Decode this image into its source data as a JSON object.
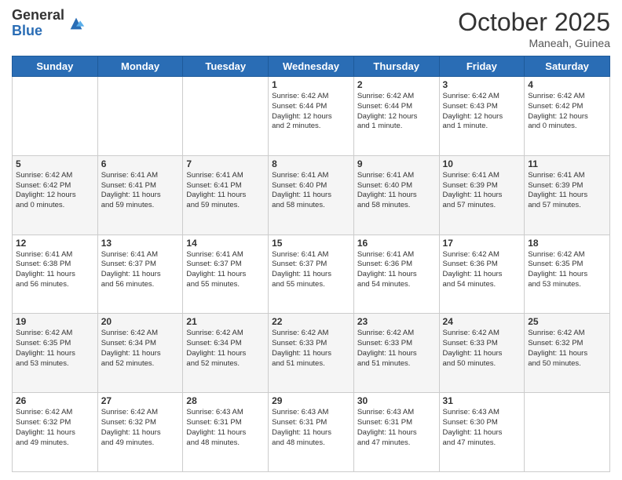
{
  "header": {
    "logo_general": "General",
    "logo_blue": "Blue",
    "month": "October 2025",
    "location": "Maneah, Guinea"
  },
  "days_of_week": [
    "Sunday",
    "Monday",
    "Tuesday",
    "Wednesday",
    "Thursday",
    "Friday",
    "Saturday"
  ],
  "weeks": [
    [
      {
        "day": "",
        "info": ""
      },
      {
        "day": "",
        "info": ""
      },
      {
        "day": "",
        "info": ""
      },
      {
        "day": "1",
        "info": "Sunrise: 6:42 AM\nSunset: 6:44 PM\nDaylight: 12 hours\nand 2 minutes."
      },
      {
        "day": "2",
        "info": "Sunrise: 6:42 AM\nSunset: 6:44 PM\nDaylight: 12 hours\nand 1 minute."
      },
      {
        "day": "3",
        "info": "Sunrise: 6:42 AM\nSunset: 6:43 PM\nDaylight: 12 hours\nand 1 minute."
      },
      {
        "day": "4",
        "info": "Sunrise: 6:42 AM\nSunset: 6:42 PM\nDaylight: 12 hours\nand 0 minutes."
      }
    ],
    [
      {
        "day": "5",
        "info": "Sunrise: 6:42 AM\nSunset: 6:42 PM\nDaylight: 12 hours\nand 0 minutes."
      },
      {
        "day": "6",
        "info": "Sunrise: 6:41 AM\nSunset: 6:41 PM\nDaylight: 11 hours\nand 59 minutes."
      },
      {
        "day": "7",
        "info": "Sunrise: 6:41 AM\nSunset: 6:41 PM\nDaylight: 11 hours\nand 59 minutes."
      },
      {
        "day": "8",
        "info": "Sunrise: 6:41 AM\nSunset: 6:40 PM\nDaylight: 11 hours\nand 58 minutes."
      },
      {
        "day": "9",
        "info": "Sunrise: 6:41 AM\nSunset: 6:40 PM\nDaylight: 11 hours\nand 58 minutes."
      },
      {
        "day": "10",
        "info": "Sunrise: 6:41 AM\nSunset: 6:39 PM\nDaylight: 11 hours\nand 57 minutes."
      },
      {
        "day": "11",
        "info": "Sunrise: 6:41 AM\nSunset: 6:39 PM\nDaylight: 11 hours\nand 57 minutes."
      }
    ],
    [
      {
        "day": "12",
        "info": "Sunrise: 6:41 AM\nSunset: 6:38 PM\nDaylight: 11 hours\nand 56 minutes."
      },
      {
        "day": "13",
        "info": "Sunrise: 6:41 AM\nSunset: 6:37 PM\nDaylight: 11 hours\nand 56 minutes."
      },
      {
        "day": "14",
        "info": "Sunrise: 6:41 AM\nSunset: 6:37 PM\nDaylight: 11 hours\nand 55 minutes."
      },
      {
        "day": "15",
        "info": "Sunrise: 6:41 AM\nSunset: 6:37 PM\nDaylight: 11 hours\nand 55 minutes."
      },
      {
        "day": "16",
        "info": "Sunrise: 6:41 AM\nSunset: 6:36 PM\nDaylight: 11 hours\nand 54 minutes."
      },
      {
        "day": "17",
        "info": "Sunrise: 6:42 AM\nSunset: 6:36 PM\nDaylight: 11 hours\nand 54 minutes."
      },
      {
        "day": "18",
        "info": "Sunrise: 6:42 AM\nSunset: 6:35 PM\nDaylight: 11 hours\nand 53 minutes."
      }
    ],
    [
      {
        "day": "19",
        "info": "Sunrise: 6:42 AM\nSunset: 6:35 PM\nDaylight: 11 hours\nand 53 minutes."
      },
      {
        "day": "20",
        "info": "Sunrise: 6:42 AM\nSunset: 6:34 PM\nDaylight: 11 hours\nand 52 minutes."
      },
      {
        "day": "21",
        "info": "Sunrise: 6:42 AM\nSunset: 6:34 PM\nDaylight: 11 hours\nand 52 minutes."
      },
      {
        "day": "22",
        "info": "Sunrise: 6:42 AM\nSunset: 6:33 PM\nDaylight: 11 hours\nand 51 minutes."
      },
      {
        "day": "23",
        "info": "Sunrise: 6:42 AM\nSunset: 6:33 PM\nDaylight: 11 hours\nand 51 minutes."
      },
      {
        "day": "24",
        "info": "Sunrise: 6:42 AM\nSunset: 6:33 PM\nDaylight: 11 hours\nand 50 minutes."
      },
      {
        "day": "25",
        "info": "Sunrise: 6:42 AM\nSunset: 6:32 PM\nDaylight: 11 hours\nand 50 minutes."
      }
    ],
    [
      {
        "day": "26",
        "info": "Sunrise: 6:42 AM\nSunset: 6:32 PM\nDaylight: 11 hours\nand 49 minutes."
      },
      {
        "day": "27",
        "info": "Sunrise: 6:42 AM\nSunset: 6:32 PM\nDaylight: 11 hours\nand 49 minutes."
      },
      {
        "day": "28",
        "info": "Sunrise: 6:43 AM\nSunset: 6:31 PM\nDaylight: 11 hours\nand 48 minutes."
      },
      {
        "day": "29",
        "info": "Sunrise: 6:43 AM\nSunset: 6:31 PM\nDaylight: 11 hours\nand 48 minutes."
      },
      {
        "day": "30",
        "info": "Sunrise: 6:43 AM\nSunset: 6:31 PM\nDaylight: 11 hours\nand 47 minutes."
      },
      {
        "day": "31",
        "info": "Sunrise: 6:43 AM\nSunset: 6:30 PM\nDaylight: 11 hours\nand 47 minutes."
      },
      {
        "day": "",
        "info": ""
      }
    ]
  ]
}
